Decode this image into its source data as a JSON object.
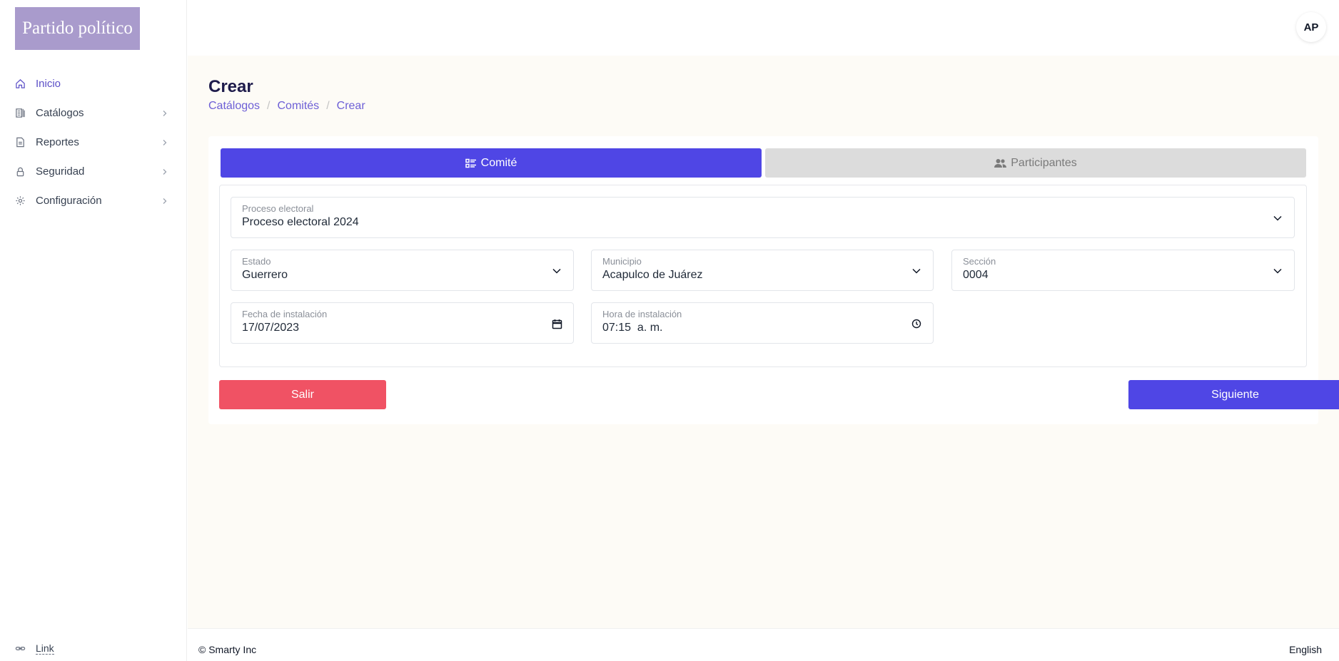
{
  "brand": {
    "logo_text": "Partido político",
    "logo_color": "#a99bcc"
  },
  "user": {
    "initials": "AP"
  },
  "sidebar": {
    "items": [
      {
        "label": "Inicio",
        "icon": "home-icon",
        "active": true
      },
      {
        "label": "Catálogos",
        "icon": "catalog-icon",
        "has_submenu": true
      },
      {
        "label": "Reportes",
        "icon": "report-icon",
        "has_submenu": true
      },
      {
        "label": "Seguridad",
        "icon": "lock-icon",
        "has_submenu": true
      },
      {
        "label": "Configuración",
        "icon": "gear-icon",
        "has_submenu": true
      }
    ],
    "link_label": "Link"
  },
  "page": {
    "title": "Crear",
    "breadcrumb": [
      "Catálogos",
      "Comités",
      "Crear"
    ]
  },
  "tabs": [
    {
      "label": "Comité",
      "icon": "list-icon",
      "active": true
    },
    {
      "label": "Participantes",
      "icon": "users-icon",
      "active": false
    }
  ],
  "form": {
    "proceso": {
      "label": "Proceso electoral",
      "value": "Proceso electoral 2024"
    },
    "estado": {
      "label": "Estado",
      "value": "Guerrero"
    },
    "municipio": {
      "label": "Municipio",
      "value": "Acapulco de Juárez"
    },
    "seccion": {
      "label": "Sección",
      "value": "0004"
    },
    "fecha": {
      "label": "Fecha de instalación",
      "value": "17/07/2023"
    },
    "hora": {
      "label": "Hora de instalación",
      "value": "07:15  a. m."
    }
  },
  "actions": {
    "exit_label": "Salir",
    "next_label": "Siguiente"
  },
  "footer": {
    "copyright": "© Smarty Inc",
    "language": "English"
  },
  "colors": {
    "primary": "#4f46e5",
    "danger": "#f05264",
    "link": "#6d5fd6"
  }
}
